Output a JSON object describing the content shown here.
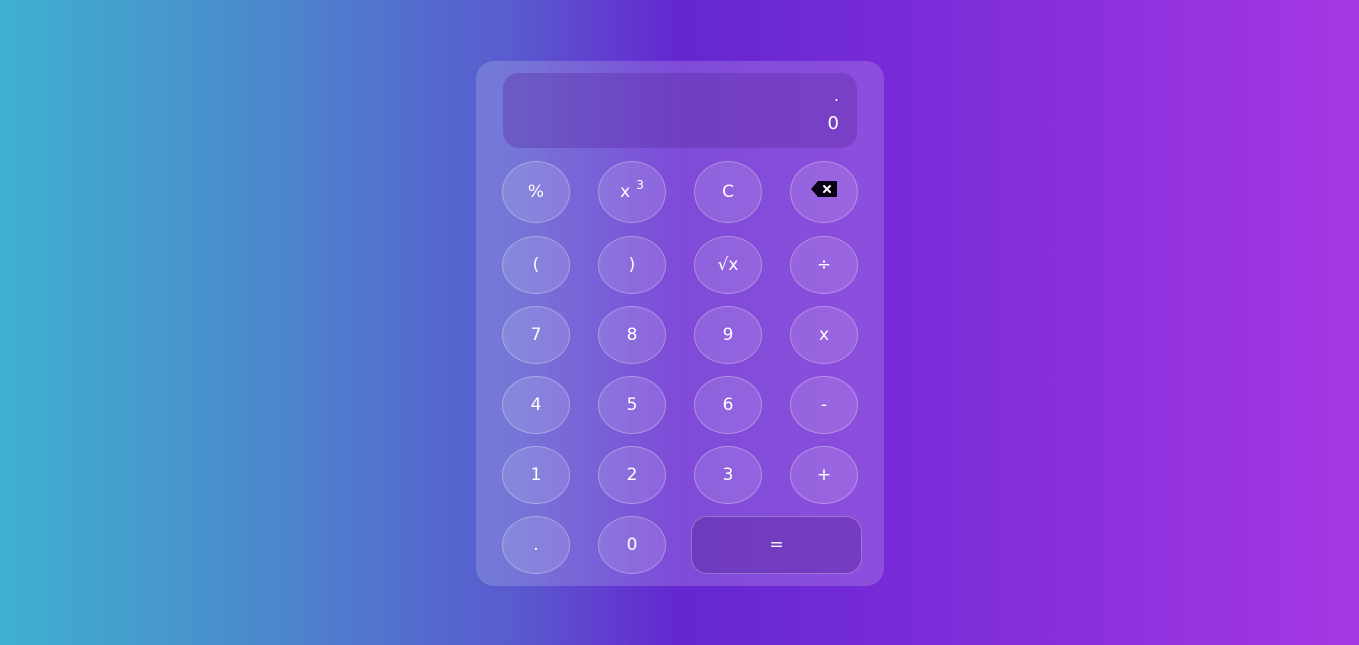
{
  "display": {
    "expression": ".",
    "result": "0"
  },
  "buttons": {
    "percent": "%",
    "cube_base": "x",
    "cube_exp": "3",
    "clear": "C",
    "backspace_icon": "backspace-icon",
    "open_paren": "(",
    "close_paren": ")",
    "sqrt": "√x",
    "divide": "÷",
    "seven": "7",
    "eight": "8",
    "nine": "9",
    "multiply": "x",
    "four": "4",
    "five": "5",
    "six": "6",
    "minus": "-",
    "one": "1",
    "two": "2",
    "three": "3",
    "plus": "+",
    "dot": ".",
    "zero": "0",
    "equals": "="
  },
  "colors": {
    "background_left": "#3fb0d0",
    "background_mid": "#6427d0",
    "background_right": "#a638e2",
    "text": "#ffffff"
  }
}
